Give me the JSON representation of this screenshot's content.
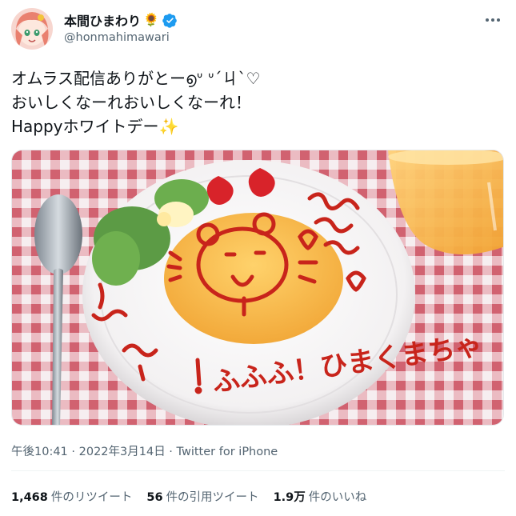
{
  "author": {
    "display_name": "本間ひまわり",
    "name_emoji": "🌻",
    "handle": "@honmahimawari",
    "verified": true,
    "avatar_icon": "avatar-icon"
  },
  "tweet": {
    "lines": [
      "オムラス配信ありがとー",
      "おいしくなーれおいしくなーれ！",
      "Happyホワイトデー"
    ],
    "line1_kaomoji": "൭ᐡ ᐡ´ㄐ`♡",
    "line3_emoji": "✨"
  },
  "photo": {
    "ketchup_text_bottom": "ふふふ！ひまくまちゃ",
    "ketchup_text_right": "ぅ~ぅ~"
  },
  "meta": {
    "time": "午後10:41",
    "date": "2022年3月14日",
    "source": "Twitter for iPhone"
  },
  "stats": {
    "retweets_count": "1,468",
    "retweets_label": "件のリツイート",
    "quotes_count": "56",
    "quotes_label": "件の引用ツイート",
    "likes_count": "1.9万",
    "likes_label": "件のいいね"
  },
  "colors": {
    "verified_blue": "#1d9bf0",
    "text_primary": "#0f1419",
    "text_secondary": "#536471",
    "ketchup": "#c8241b"
  }
}
